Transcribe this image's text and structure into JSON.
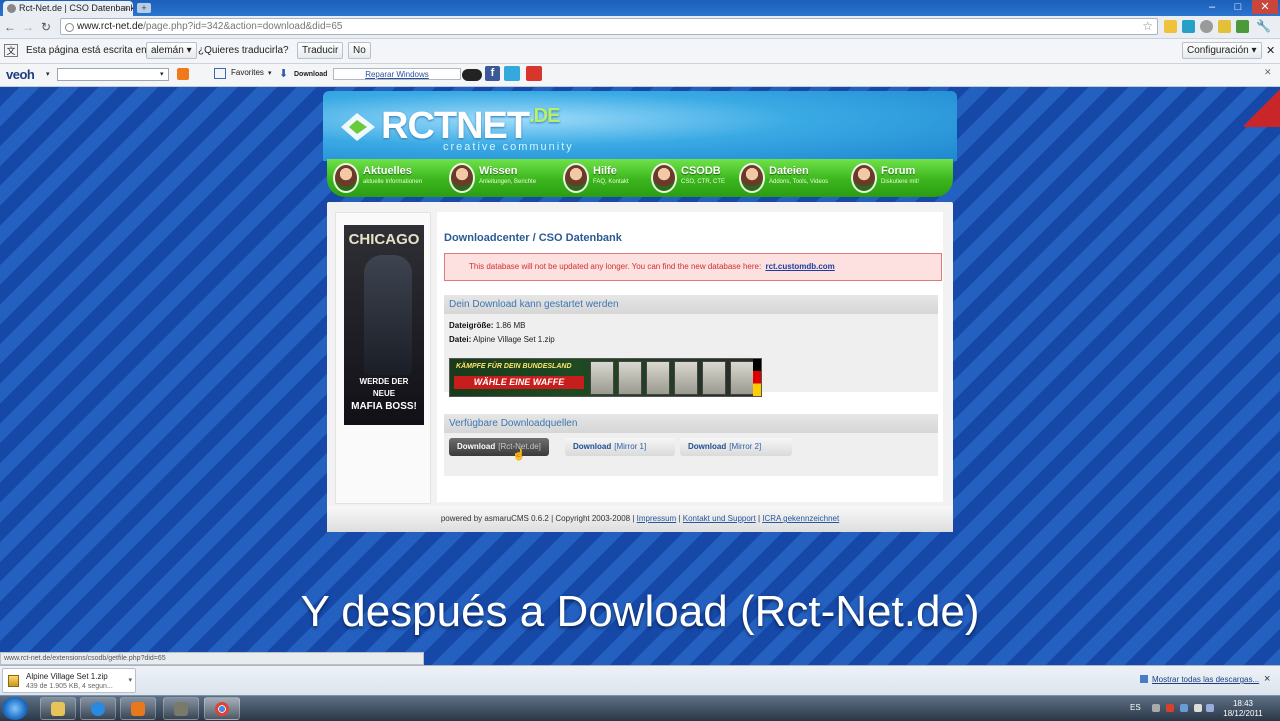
{
  "browser": {
    "tab_title": "Rct-Net.de | CSO Datenbank",
    "tab_close": "×",
    "new_tab": "+",
    "url_host": "www.rct-net.de",
    "url_path": "/page.php?id=342&action=download&did=65"
  },
  "translate_bar": {
    "message": "Esta página está escrita en",
    "language": "alemán",
    "question": "¿Quieres traducirla?",
    "translate_button": "Traducir",
    "no_button": "No",
    "settings_button": "Configuración"
  },
  "veoh_bar": {
    "logo": "veoh",
    "favorites": "Favorites",
    "download": "Download",
    "repair": "Reparar Windows"
  },
  "site": {
    "logo_main": "RCTNET",
    "logo_tld": ".DE",
    "tagline": "creative community",
    "nav": [
      {
        "label": "Aktuelles",
        "sub": "aktuelle Informationen"
      },
      {
        "label": "Wissen",
        "sub": "Anleitungen, Berichte"
      },
      {
        "label": "Hilfe",
        "sub": "FAQ, Kontakt"
      },
      {
        "label": "CSODB",
        "sub": "CSO, CTR, CTE"
      },
      {
        "label": "Dateien",
        "sub": "Addons, Tools, Videos"
      },
      {
        "label": "Forum",
        "sub": "Diskutiere mit!"
      }
    ]
  },
  "ad": {
    "headline": "CHICAGO",
    "line1": "WERDE DER",
    "line2": "NEUE",
    "line3": "MAFIA BOSS!"
  },
  "download": {
    "title": "Downloadcenter / CSO Datenbank",
    "alert_text": "This database will not be updated any longer. You can find the new database here:",
    "alert_link": "rct.customdb.com",
    "section1_title": "Dein Download kann gestartet werden",
    "size_label": "Dateigröße:",
    "size_value": "1.86 MB",
    "file_label": "Datei:",
    "file_value": "Alpine Village Set 1.zip",
    "banner_line1": "KÄMPFE FÜR DEIN BUNDESLAND",
    "banner_line2": "WÄHLE EINE WAFFE",
    "section2_title": "Verfügbare Downloadquellen",
    "buttons": [
      {
        "label": "Download",
        "mirror": "[Rct-Net.de]"
      },
      {
        "label": "Download",
        "mirror": "[Mirror 1]"
      },
      {
        "label": "Download",
        "mirror": "[Mirror 2]"
      }
    ]
  },
  "footer": {
    "text": "powered by asmaruCMS 0.6.2 | Copyright 2003-2008 |",
    "impressum": "Impressum",
    "kontakt": "Kontakt und Support",
    "icra": "ICRA gekennzeichnet",
    "sep": "|"
  },
  "subtitle": "Y después a Dowload (Rct-Net.de)",
  "status_url": "www.rct-net.de/extensions/csodb/getfile.php?did=65",
  "download_shelf": {
    "filename": "Alpine Village Set 1.zip",
    "progress": "439 de 1.905 KB, 4 segun...",
    "show_all": "Mostrar todas las descargas...",
    "close": "×"
  },
  "taskbar": {
    "language": "ES",
    "time": "18:43",
    "date": "18/12/2011"
  }
}
